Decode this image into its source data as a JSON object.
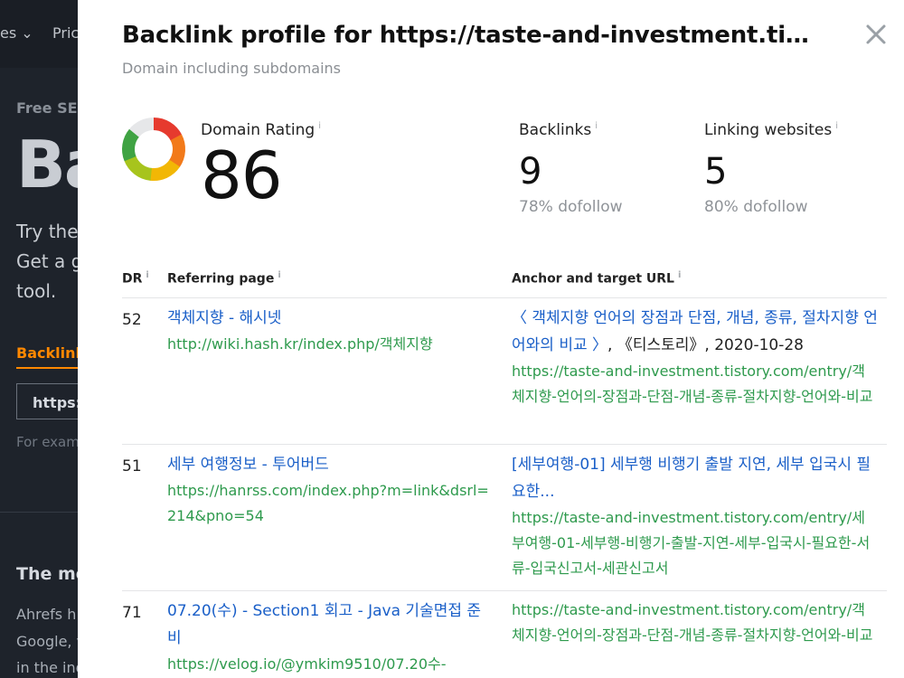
{
  "background": {
    "nav_items": [
      "es ⌄",
      "Pric"
    ],
    "free_label": "Free SEO",
    "hero_title": "Ba",
    "intro_lines": [
      "Try the",
      "Get a g",
      "tool."
    ],
    "tab_label": "Backlink",
    "input_value": "https:",
    "example_text": "For exam",
    "section_heading": "The mo",
    "section_lines": [
      "Ahrefs h",
      "Google, v",
      "in the ind"
    ]
  },
  "modal": {
    "title": "Backlink profile for https://taste-and-investment.tistory.com/",
    "subtitle": "Domain including subdomains",
    "close_icon": "close-icon",
    "stats": {
      "domain_rating": {
        "label": "Domain Rating",
        "value": "86",
        "gauge_fraction": 0.86
      },
      "backlinks": {
        "label": "Backlinks",
        "value": "9",
        "sub": "78% dofollow"
      },
      "linking_websites": {
        "label": "Linking websites",
        "value": "5",
        "sub": "80% dofollow"
      }
    },
    "info_glyph": "i",
    "table": {
      "headers": {
        "dr": "DR",
        "referring_page": "Referring page",
        "anchor": "Anchor and target URL"
      },
      "rows": [
        {
          "dr": "52",
          "ref_title": "객체지향 - 해시넷",
          "ref_url": "http://wiki.hash.kr/index.php/객체지향",
          "anchor_text": "〈 객체지향 언어의 장점과 단점, 개념, 종류, 절차지향 언어와의 비교 〉",
          "anchor_suffix": ", 《티스토리》, 2020-10-28",
          "target_url": "https://taste-and-investment.tistory.com/entry/객체지향-언어의-장점과-단점-개념-종류-절차지향-언어와-비교"
        },
        {
          "dr": "51",
          "ref_title": "세부 여행정보 - 투어버드",
          "ref_url": "https://hanrss.com/index.php?m=link&dsrl=214&pno=54",
          "anchor_text": "[세부여행-01] 세부행 비행기 출발 지연, 세부 입국시 필요한...",
          "anchor_suffix": "",
          "target_url": "https://taste-and-investment.tistory.com/entry/세부여행-01-세부행-비행기-출발-지연-세부-입국시-필요한-서류-입국신고서-세관신고서"
        },
        {
          "dr": "71",
          "ref_title": "07.20(수) - Section1 회고 - Java 기술면접 준비",
          "ref_url": "https://velog.io/@ymkim9510/07.20수-",
          "anchor_text": "",
          "anchor_suffix": "",
          "target_url": "https://taste-and-investment.tistory.com/entry/객체지향-언어의-장점과-단점-개념-종류-절차지향-언어와-비교"
        }
      ]
    }
  },
  "colors": {
    "overlay_bg": "#1e232b",
    "link_blue": "#1a5fc8",
    "url_green": "#2e9a4d",
    "accent_orange": "#ff8800",
    "gauge_gradient": [
      "#e63a2e",
      "#f27a1a",
      "#f2b705",
      "#a7c41d",
      "#3fa343"
    ]
  }
}
